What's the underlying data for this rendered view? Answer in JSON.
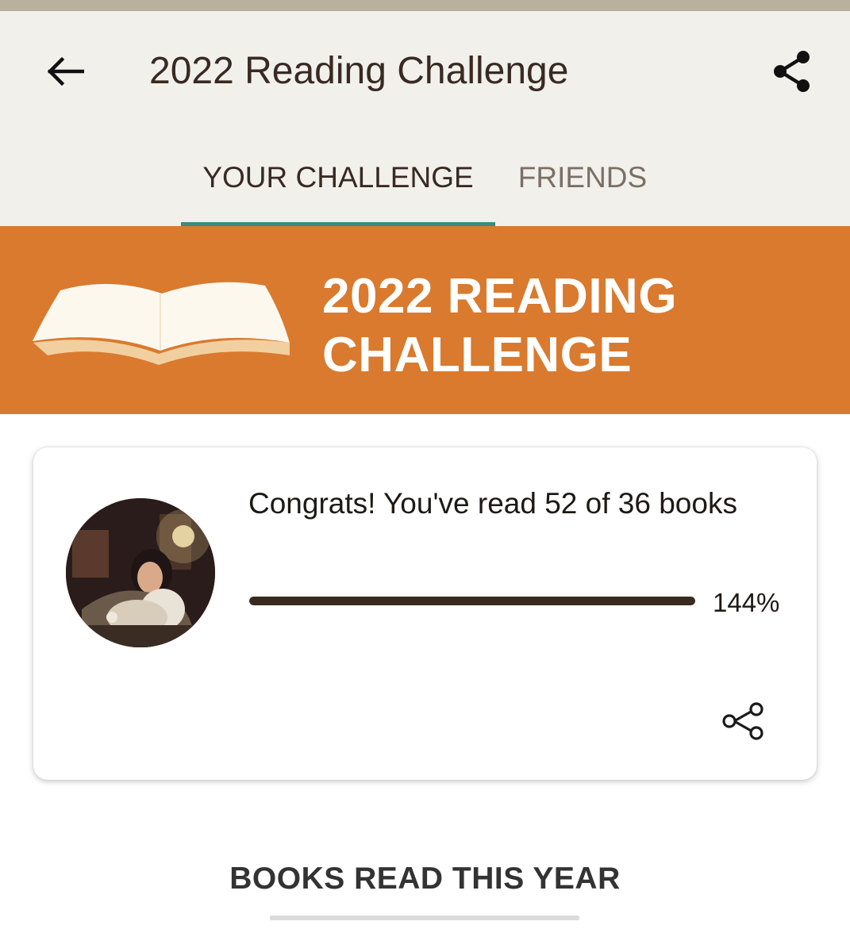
{
  "header": {
    "title": "2022 Reading Challenge",
    "back_icon": "arrow-left-icon",
    "share_icon": "share-icon"
  },
  "tabs": [
    {
      "label": "YOUR CHALLENGE",
      "active": true
    },
    {
      "label": "FRIENDS",
      "active": false
    }
  ],
  "banner": {
    "title_line1": "2022 READING",
    "title_line2": "CHALLENGE",
    "illustration_icon": "open-book-icon"
  },
  "progress_card": {
    "message": "Congrats! You've read 52 of 36 books",
    "books_read": 52,
    "books_goal": 36,
    "percent_label": "144%",
    "progress_fraction": 1.0,
    "avatar_icon": "user-avatar",
    "share_icon": "share-outline-icon"
  },
  "section": {
    "title": "BOOKS READ THIS YEAR"
  },
  "colors": {
    "header_bg": "#f2f0eb",
    "banner_bg": "#d97a2e",
    "tab_indicator": "#3d8a7f",
    "progress_fill": "#382a1e",
    "text_primary": "#382a23"
  }
}
